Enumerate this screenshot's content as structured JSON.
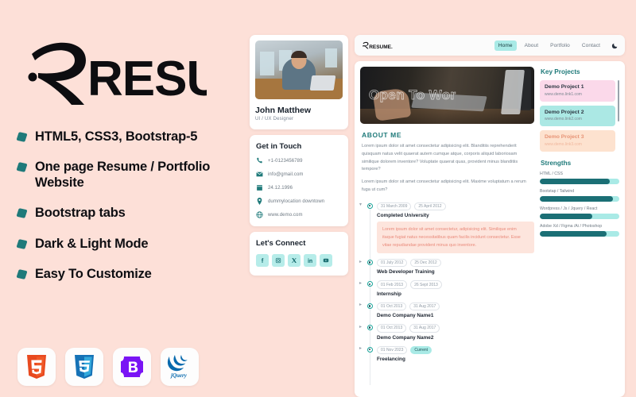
{
  "promo": {
    "logo_text": "RESUME.",
    "features": [
      "HTML5, CSS3, Bootstrap-5",
      "One page Resume / Portfolio Website",
      "Bootstrap tabs",
      "Dark & Light Mode",
      "Easy To Customize"
    ],
    "tech_badges": [
      {
        "name": "html5-badge",
        "label": "5"
      },
      {
        "name": "css3-badge",
        "label": "3"
      },
      {
        "name": "bootstrap-badge",
        "label": "B"
      },
      {
        "name": "jquery-badge",
        "label": "jQuery"
      }
    ],
    "colors": {
      "background": "#fde0d8",
      "bullet": "#1f7a7a",
      "text": "#0e0e12"
    }
  },
  "preview": {
    "navbar": {
      "logo_text": "RESUME.",
      "links": [
        {
          "label": "Home",
          "active": true
        },
        {
          "label": "About",
          "active": false
        },
        {
          "label": "Portfolio",
          "active": false
        },
        {
          "label": "Contact",
          "active": false
        }
      ],
      "theme_toggle": "moon-icon",
      "active_color": "#a9eae6"
    },
    "profile": {
      "name": "John Matthew",
      "role": "UI / UX Designer"
    },
    "contact": {
      "heading": "Get in Touch",
      "items": [
        {
          "icon": "phone-icon",
          "text": "+1-0123456789"
        },
        {
          "icon": "mail-icon",
          "text": "info@gmail.com"
        },
        {
          "icon": "calendar-icon",
          "text": "24.12.1996"
        },
        {
          "icon": "location-icon",
          "text": "dummylocation downtown"
        },
        {
          "icon": "globe-icon",
          "text": "www.demo.com"
        }
      ]
    },
    "connect": {
      "heading": "Let's Connect",
      "socials": [
        "facebook-icon",
        "instagram-icon",
        "x-icon",
        "linkedin-icon",
        "youtube-icon"
      ]
    },
    "hero": {
      "text": "Open To Wor"
    },
    "about": {
      "heading": "ABOUT ME",
      "paragraphs": [
        "Lorem ipsum dolor sit amet consectetur adipisicing elit. Blanditiis reprehenderit quisquam natus velit quaerat autem cumque atque, corporis aliquid laboriosam similique dolorem inventore? Voluptate quaerat quas, provident minus blanditiis tempore?",
        "Lorem ipsum dolor sit amet consectetur adipisicing elit. Maxime voluptatum a rerum fuga ut cum?"
      ]
    },
    "timeline": [
      {
        "start": "31 March 2009",
        "end": "25 April 2012",
        "end_current": false,
        "title": "Completed University",
        "expanded": true,
        "body": "Lorem ipsum dolor sit amet consectetur, adipisicing elit. Similique enim itaque fugiat natus necessitatibus quam facilis incidunt consectetur. Esse vitae repudiandae provident minus quo inventore."
      },
      {
        "start": "01 July 2012",
        "end": "25 Dec 2012",
        "end_current": false,
        "title": "Web Developer Training",
        "expanded": false,
        "body": ""
      },
      {
        "start": "01 Feb 2013",
        "end": "26 Sept 2013",
        "end_current": false,
        "title": "Internship",
        "expanded": false,
        "body": ""
      },
      {
        "start": "01 Oct 2013",
        "end": "31 Aug 2017",
        "end_current": false,
        "title": "Demo Company Name1",
        "expanded": false,
        "body": ""
      },
      {
        "start": "01 Oct 2013",
        "end": "31 Aug 2017",
        "end_current": false,
        "title": "Demo Company Name2",
        "expanded": false,
        "body": ""
      },
      {
        "start": "01 Nov 2023",
        "end": "Current",
        "end_current": true,
        "title": "Freelancing",
        "expanded": false,
        "body": ""
      }
    ],
    "key_projects": {
      "heading": "Key Projects",
      "items": [
        {
          "title": "Demo Project 1",
          "link": "www.demo.link1.com",
          "color": "#fbd9ea"
        },
        {
          "title": "Demo Project 2",
          "link": "www.demo.link2.com",
          "color": "#abe8e4"
        },
        {
          "title": "Demo Project 3",
          "link": "www.demo.link3.com",
          "color": "#fde2cf"
        }
      ]
    },
    "strengths": {
      "heading": "Strengths",
      "items": [
        {
          "label": "HTML / CSS",
          "percent": 88
        },
        {
          "label": "Bootstap / Tailwind",
          "percent": 92
        },
        {
          "label": "Wordpress / Js / Jquery / React",
          "percent": 66
        },
        {
          "label": "Adobe Xd / Figma /Ai / Photoshop",
          "percent": 84
        }
      ]
    }
  }
}
